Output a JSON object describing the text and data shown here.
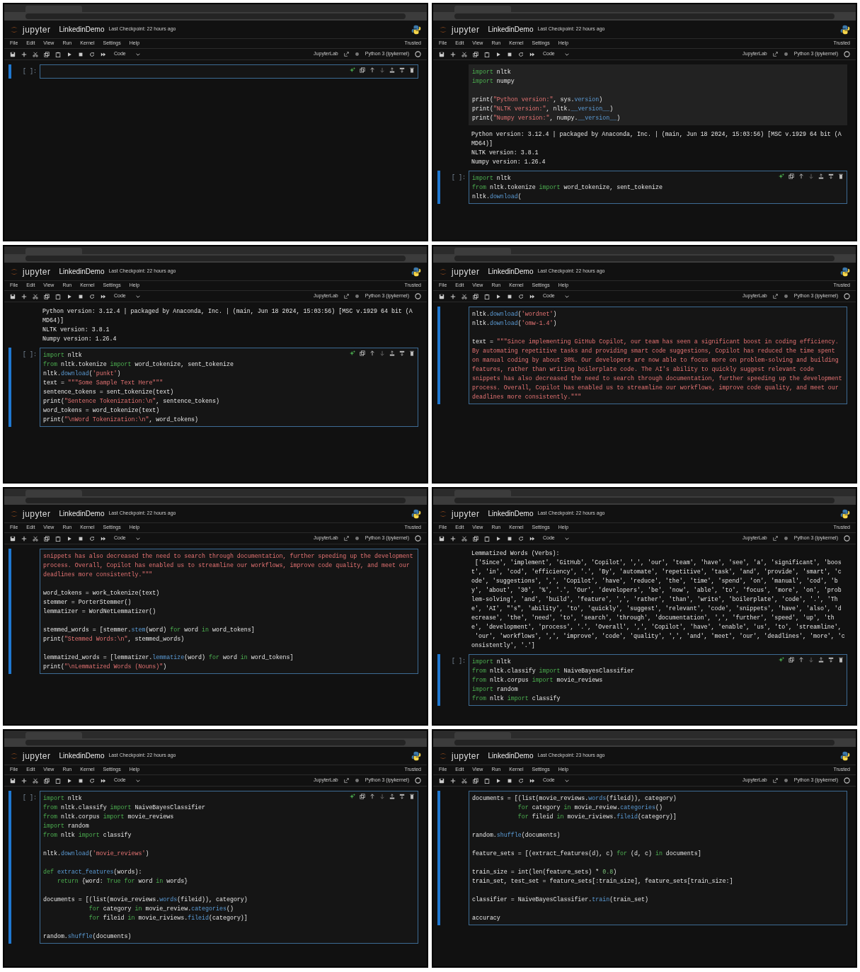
{
  "panels": [
    {
      "logo_text": "jupyter",
      "notebook": "LinkedinDemo",
      "checkpoint": "Last Checkpoint: 22 hours ago",
      "menu": [
        "File",
        "Edit",
        "View",
        "Run",
        "Kernel",
        "Settings",
        "Help"
      ],
      "trust": "Trusted",
      "cell_type": "Code",
      "lab_link": "JupyterLab",
      "kernel": "Python 3 (ipykernel)",
      "cells": [
        {
          "kind": "code",
          "prompt": "[ ]:",
          "active": true,
          "toolbar": true
        }
      ]
    },
    {
      "logo_text": "jupyter",
      "notebook": "LinkedinDemo",
      "checkpoint": "Last Checkpoint: 22 hours ago",
      "menu": [
        "File",
        "Edit",
        "View",
        "Run",
        "Kernel",
        "Settings",
        "Help"
      ],
      "trust": "Trusted",
      "cell_type": "Code",
      "lab_link": "JupyterLab",
      "kernel": "Python 3 (ipykernel)",
      "cells": [
        {
          "kind": "code",
          "active": false,
          "toolbar": false,
          "blocks": [
            [
              [
                {
                  "kw": "import"
                },
                " nltk"
              ],
              [
                {
                  "kw": "import"
                },
                " numpy"
              ]
            ],
            [
              [
                "print(",
                {
                  "str": "\"Python version:\""
                },
                ", sys.",
                {
                  "fn": "version"
                },
                ")"
              ],
              [
                "print(",
                {
                  "str": "\"NLTK version:\""
                },
                ", nltk.",
                {
                  "fn": "__version__"
                },
                ")"
              ],
              [
                "print(",
                {
                  "str": "\"Numpy version:\""
                },
                ", numpy.",
                {
                  "fn": "__version__"
                },
                ")"
              ]
            ]
          ]
        },
        {
          "kind": "output",
          "lines": [
            "Python version: 3.12.4 | packaged by Anaconda, Inc. | (main, Jun 18 2024, 15:03:56) [MSC v.1929 64 bit (A",
            "MD64)]",
            "NLTK version: 3.8.1",
            "Numpy version: 1.26.4"
          ]
        },
        {
          "kind": "code",
          "prompt": "[ ]:",
          "active": true,
          "toolbar": true,
          "blocks": [
            [
              [
                {
                  "kw": "import"
                },
                " nltk"
              ],
              [
                {
                  "kw": "from"
                },
                " nltk.tokenize ",
                {
                  "kw": "import"
                },
                " word_tokenize, sent_tokenize"
              ],
              [
                "nltk.",
                {
                  "fn": "download"
                },
                "("
              ]
            ]
          ]
        }
      ]
    },
    {
      "logo_text": "jupyter",
      "notebook": "LinkedinDemo",
      "checkpoint": "Last Checkpoint: 22 hours ago",
      "menu": [
        "File",
        "Edit",
        "View",
        "Run",
        "Kernel",
        "Settings",
        "Help"
      ],
      "trust": "Trusted",
      "cell_type": "Code",
      "lab_link": "JupyterLab",
      "kernel": "Python 3 (ipykernel)",
      "cells": [
        {
          "kind": "output",
          "lines": [
            "Python version: 3.12.4 | packaged by Anaconda, Inc. | (main, Jun 18 2024, 15:03:56) [MSC v.1929 64 bit (A",
            "MD64)]",
            "NLTK version: 3.8.1",
            "Numpy version: 1.26.4"
          ]
        },
        {
          "kind": "code",
          "prompt": "[ ]:",
          "active": true,
          "toolbar": true,
          "blocks": [
            [
              [
                {
                  "kw": "import"
                },
                " nltk"
              ],
              [
                {
                  "kw": "from"
                },
                " nltk.tokenize ",
                {
                  "kw": "import"
                },
                " word_tokenize, sent_tokenize"
              ],
              [
                "nltk.",
                {
                  "fn": "download"
                },
                "(",
                {
                  "str": "'punkt'"
                },
                ")"
              ],
              [
                "text = ",
                {
                  "str": "\"\"\"Some Sample Text Here\"\"\""
                }
              ],
              [
                "sentence_tokens = sent_tokenize(text)"
              ],
              [
                "print(",
                {
                  "str": "\"Sentence Tokenization:\\n\""
                },
                ", sentence_tokens)"
              ],
              [
                "word_tokens = word_tokenize(text)"
              ],
              [
                "print(",
                {
                  "str": "\"\\nWord Tokenization:\\n\""
                },
                ", word_tokens)"
              ]
            ]
          ]
        }
      ]
    },
    {
      "logo_text": "jupyter",
      "notebook": "LinkedinDemo",
      "checkpoint": "Last Checkpoint: 22 hours ago",
      "menu": [
        "File",
        "Edit",
        "View",
        "Run",
        "Kernel",
        "Settings",
        "Help"
      ],
      "trust": "Trusted",
      "cell_type": "Code",
      "lab_link": "JupyterLab",
      "kernel": "Python 3 (ipykernel)",
      "cells": [
        {
          "kind": "code",
          "active": true,
          "toolbar": false,
          "blocks": [
            [
              [
                "nltk.",
                {
                  "fn": "download"
                },
                "(",
                {
                  "str": "'wordnet'"
                },
                ")"
              ],
              [
                "nltk.",
                {
                  "fn": "download"
                },
                "(",
                {
                  "str": "'omw-1.4'"
                },
                ")"
              ]
            ],
            [
              [
                "text = ",
                {
                  "str": "\"\"\"Since implementing GitHub Copilot, our team has seen a significant boost in coding efficiency."
                }
              ],
              [
                {
                  "str": "By automating repetitive tasks and providing smart code suggestions, Copilot has reduced the time spent"
                }
              ],
              [
                {
                  "str": "on manual coding by about 30%. Our developers are now able to focus more on problem-solving and building"
                }
              ],
              [
                {
                  "str": "features, rather than writing boilerplate code. The AI's ability to quickly suggest relevant code"
                }
              ],
              [
                {
                  "str": "snippets has also decreased the need to search through documentation, further speeding up the development"
                }
              ],
              [
                {
                  "str": "process. Overall, Copilot has enabled us to streamline our workflows, improve code quality, and meet our"
                }
              ],
              [
                {
                  "str": "deadlines more consistently.\"\"\""
                }
              ]
            ]
          ]
        }
      ]
    },
    {
      "logo_text": "jupyter",
      "notebook": "LinkedinDemo",
      "checkpoint": "Last Checkpoint: 22 hours ago",
      "menu": [
        "File",
        "Edit",
        "View",
        "Run",
        "Kernel",
        "Settings",
        "Help"
      ],
      "trust": "Trusted",
      "cell_type": "Code",
      "lab_link": "JupyterLab",
      "kernel": "Python 3 (ipykernel)",
      "cells": [
        {
          "kind": "code",
          "active": true,
          "toolbar": false,
          "blocks": [
            [
              [
                {
                  "str": "snippets has also decreased the need to search through documentation, further speeding up the development"
                }
              ],
              [
                {
                  "str": "process. Overall, Copilot has enabled us to streamline our workflows, improve code quality, and meet our"
                }
              ],
              [
                {
                  "str": "deadlines more consistently.\"\"\""
                }
              ]
            ],
            [
              [
                "word_tokens = work_tokenize(text)"
              ],
              [
                "stemmer = PorterStemmer()"
              ],
              [
                "lemmatizer = WordNetLemmatizer()"
              ]
            ],
            [
              [
                "stemmed_words = [stemmer.",
                {
                  "fn": "stem"
                },
                "(word) ",
                {
                  "kw": "for"
                },
                " word ",
                {
                  "kw": "in"
                },
                " word_tokens]"
              ],
              [
                "print(",
                {
                  "str": "\"Stemmed Words:\\n\""
                },
                ", stemmed_words)"
              ]
            ],
            [
              [
                "lemmatized_words = [lemmatizer.",
                {
                  "fn": "lemmatize"
                },
                "(word) ",
                {
                  "kw": "for"
                },
                " word ",
                {
                  "kw": "in"
                },
                " word_tokens]"
              ],
              [
                "print(",
                {
                  "str": "\"\\nLemmatized Words (Nouns)\""
                },
                ")"
              ]
            ]
          ]
        }
      ]
    },
    {
      "logo_text": "jupyter",
      "notebook": "LinkedinDemo",
      "checkpoint": "Last Checkpoint: 22 hours ago",
      "menu": [
        "File",
        "Edit",
        "View",
        "Run",
        "Kernel",
        "Settings",
        "Help"
      ],
      "trust": "Trusted",
      "cell_type": "Code",
      "lab_link": "JupyterLab",
      "kernel": "Python 3 (ipykernel)",
      "cells": [
        {
          "kind": "output",
          "lines": [
            "Lemmatized Words (Verbs):",
            " ['Since', 'implement', 'GitHub', 'Copilot', ',', 'our', 'team', 'have', 'see', 'a', 'significant', 'boos",
            "t', 'in', 'cod', 'efficiency', '.', 'By', 'automate', 'repetitive', 'task', 'and', 'provide', 'smart', 'c",
            "ode', 'suggestions', ',', 'Copilot', 'have', 'reduce', 'the', 'time', 'spend', 'on', 'manual', 'cod', 'b",
            "y', 'about', '30', '%', '.', 'Our', 'developers', 'be', 'now', 'able', 'to', 'focus', 'more', 'on', 'prob",
            "lem-solving', 'and', 'build', 'feature', ',', 'rather', 'than', 'write', 'boilerplate', 'code', '.', 'Th",
            "e', 'AI', \"'s\", 'ability', 'to', 'quickly', 'suggest', 'relevant', 'code', 'snippets', 'have', 'also', 'd",
            "ecrease', 'the', 'need', 'to', 'search', 'through', 'documentation', ',', 'further', 'speed', 'up', 'th",
            "e', 'development', 'process', '.', 'Overall', ',', 'Copilot', 'have', 'enable', 'us', 'to', 'streamline',",
            " 'our', 'workflows', ',', 'improve', 'code', 'quality', ',', 'and', 'meet', 'our', 'deadlines', 'more', 'c",
            "onsistently', '.']"
          ]
        },
        {
          "kind": "code",
          "prompt": "[ ]:",
          "active": true,
          "toolbar": true,
          "blocks": [
            [
              [
                {
                  "kw": "import"
                },
                " nltk"
              ],
              [
                {
                  "kw": "from"
                },
                " nltk.classify ",
                {
                  "kw": "import"
                },
                " NaiveBayesClassifier"
              ],
              [
                {
                  "kw": "from"
                },
                " nltk.corpus ",
                {
                  "kw": "import"
                },
                " movie_reviews"
              ],
              [
                {
                  "kw": "import"
                },
                " random"
              ],
              [
                {
                  "kw": "from"
                },
                " nltk ",
                {
                  "kw": "import"
                },
                " classify"
              ]
            ]
          ]
        }
      ]
    },
    {
      "logo_text": "jupyter",
      "notebook": "LinkedinDemo",
      "checkpoint": "Last Checkpoint: 22 hours ago",
      "menu": [
        "File",
        "Edit",
        "View",
        "Run",
        "Kernel",
        "Settings",
        "Help"
      ],
      "trust": "Trusted",
      "cell_type": "Code",
      "lab_link": "JupyterLab",
      "kernel": "Python 3 (ipykernel)",
      "cells": [
        {
          "kind": "code",
          "prompt": "[ ]:",
          "active": true,
          "toolbar": true,
          "blocks": [
            [
              [
                {
                  "kw": "import"
                },
                " nltk"
              ],
              [
                {
                  "kw": "from"
                },
                " nltk.classify ",
                {
                  "kw": "import"
                },
                " NaiveBayesClassifier"
              ],
              [
                {
                  "kw": "from"
                },
                " nltk.corpus ",
                {
                  "kw": "import"
                },
                " movie_reviews"
              ],
              [
                {
                  "kw": "import"
                },
                " random"
              ],
              [
                {
                  "kw": "from"
                },
                " nltk ",
                {
                  "kw": "import"
                },
                " classify"
              ]
            ],
            [
              [
                "nltk.",
                {
                  "fn": "download"
                },
                "(",
                {
                  "str": "'movie_reviews'"
                },
                ")"
              ]
            ],
            [
              [
                {
                  "kw": "def"
                },
                {
                  "fn": " extract_features"
                },
                "(words):"
              ],
              [
                {
                  "kw": "    return"
                },
                " {word: ",
                {
                  "kw": "True for"
                },
                " word ",
                {
                  "kw": "in"
                },
                " words}"
              ]
            ],
            [
              [
                "documents = [(list(movie_reviews.",
                {
                  "fn": "words"
                },
                "(fileid)), category)"
              ],
              [
                {
                  "kw": "             for"
                },
                " category ",
                {
                  "kw": "in"
                },
                " movie_review.",
                {
                  "fn": "categories"
                },
                "()"
              ],
              [
                {
                  "kw": "             for"
                },
                " fileid ",
                {
                  "kw": "in"
                },
                " movie_riviews.",
                {
                  "fn": "fileid"
                },
                "(category)]"
              ]
            ],
            [
              [
                "random.",
                {
                  "fn": "shuffle"
                },
                "(documents)"
              ]
            ]
          ]
        }
      ]
    },
    {
      "logo_text": "jupyter",
      "notebook": "LinkedinDemo",
      "checkpoint": "Last Checkpoint: 23 hours ago",
      "menu": [
        "File",
        "Edit",
        "View",
        "Run",
        "Kernel",
        "Settings",
        "Help"
      ],
      "trust": "Trusted",
      "cell_type": "Code",
      "lab_link": "JupyterLab",
      "kernel": "Python 3 (ipykernel)",
      "cells": [
        {
          "kind": "code",
          "active": true,
          "toolbar": false,
          "blocks": [
            [
              [
                "documents = [(list(movie_reviews.",
                {
                  "fn": "words"
                },
                "(fileid)), category)"
              ],
              [
                {
                  "kw": "             for"
                },
                " category ",
                {
                  "kw": "in"
                },
                " movie_review.",
                {
                  "fn": "categories"
                },
                "()"
              ],
              [
                {
                  "kw": "             for"
                },
                " fileid ",
                {
                  "kw": "in"
                },
                " movie_riviews.",
                {
                  "fn": "fileid"
                },
                "(category)]"
              ]
            ],
            [
              [
                "random.",
                {
                  "fn": "shuffle"
                },
                "(documents)"
              ]
            ],
            [
              [
                "feature_sets = [(extract_features(d), c) ",
                {
                  "kw": "for"
                },
                " (d, c) ",
                {
                  "kw": "in"
                },
                " documents]"
              ]
            ],
            [
              [
                "train_size = int(len(feature_sets) * ",
                {
                  "num": "0.8"
                },
                ")"
              ],
              [
                "train_set, test_set = feature_sets[:train_size], feature_sets[train_size:]"
              ]
            ],
            [
              [
                "classifier = NaiveBayesClassifier.",
                {
                  "fn": "train"
                },
                "(train_set)"
              ]
            ],
            [
              [
                "accuracy"
              ]
            ]
          ]
        }
      ]
    }
  ]
}
